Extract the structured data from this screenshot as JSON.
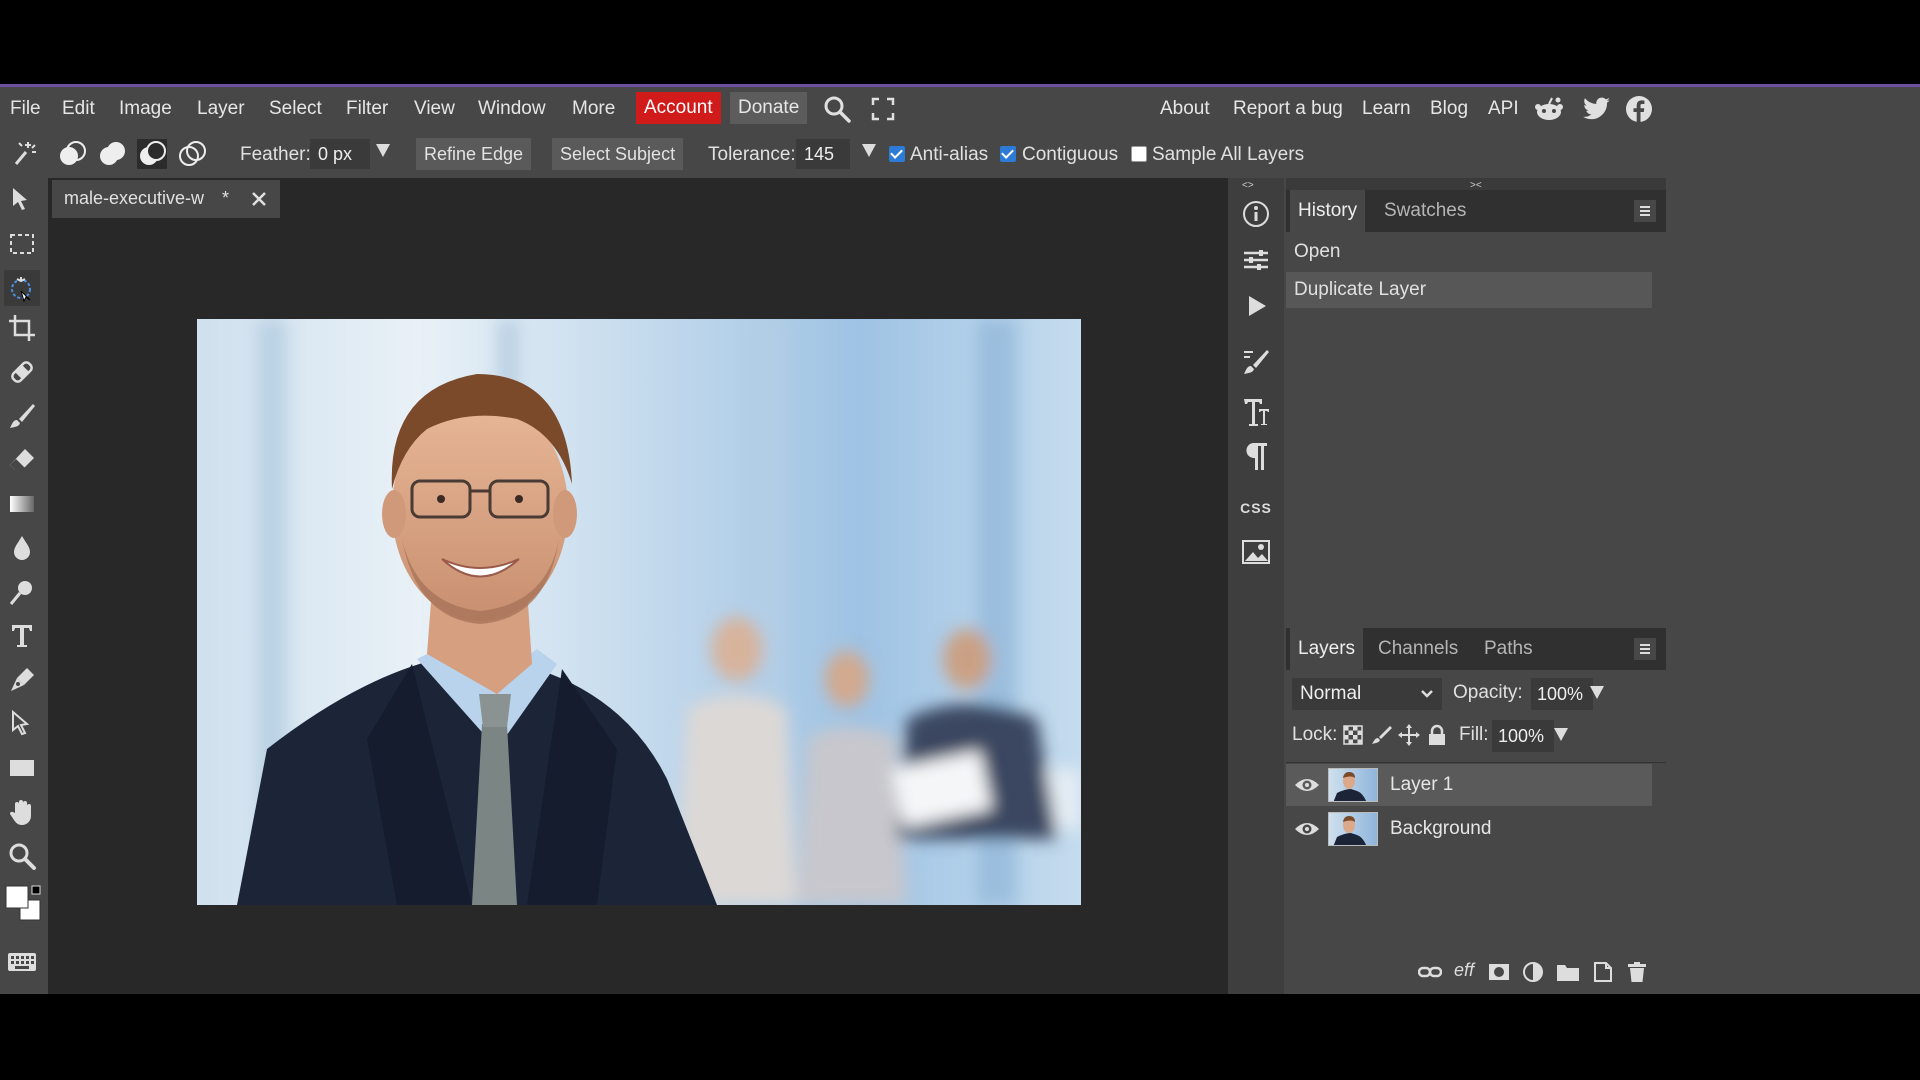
{
  "menu": {
    "items": [
      "File",
      "Edit",
      "Image",
      "Layer",
      "Select",
      "Filter",
      "View",
      "Window",
      "More"
    ],
    "account": "Account",
    "donate": "Donate",
    "right_links": [
      "About",
      "Report a bug",
      "Learn",
      "Blog",
      "API"
    ]
  },
  "options": {
    "feather_label": "Feather:",
    "feather_value": "0 px",
    "refine_edge": "Refine Edge",
    "select_subject": "Select Subject",
    "tolerance_label": "Tolerance:",
    "tolerance_value": "145",
    "anti_alias": "Anti-alias",
    "anti_alias_checked": true,
    "contiguous": "Contiguous",
    "contiguous_checked": true,
    "sample_all": "Sample All Layers",
    "sample_all_checked": false
  },
  "document": {
    "tab_title": "male-executive-w",
    "modified_marker": "*"
  },
  "history": {
    "tabs": [
      "History",
      "Swatches"
    ],
    "entries": [
      "Open",
      "Duplicate Layer"
    ]
  },
  "layers": {
    "tabs": [
      "Layers",
      "Channels",
      "Paths"
    ],
    "blend_mode": "Normal",
    "opacity_label": "Opacity:",
    "opacity_value": "100%",
    "lock_label": "Lock:",
    "fill_label": "Fill:",
    "fill_value": "100%",
    "items": [
      "Layer 1",
      "Background"
    ]
  },
  "side": {
    "css_label": "CSS"
  },
  "colors": {
    "accent": "#d11a1a",
    "checkbox": "#2c7bd6",
    "topline": "#6d4fa0"
  }
}
